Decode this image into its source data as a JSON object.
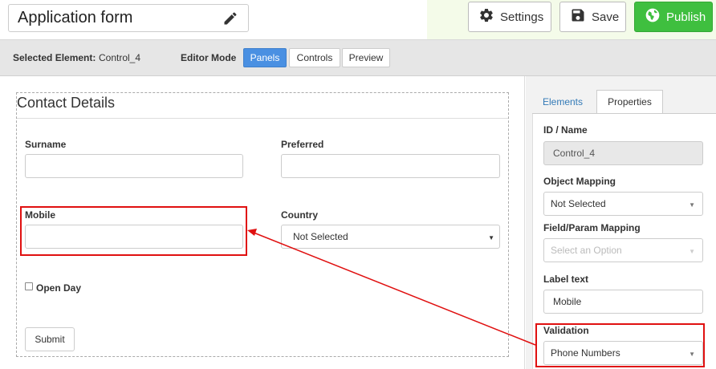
{
  "header": {
    "form_title": "Application form",
    "settings_label": "Settings",
    "save_label": "Save",
    "publish_label": "Publish"
  },
  "toolbar": {
    "selected_element_label": "Selected Element:",
    "selected_element_value": "Control_4",
    "editor_mode_label": "Editor Mode",
    "modes": [
      "Panels",
      "Controls",
      "Preview"
    ],
    "active_mode": "Panels"
  },
  "form": {
    "panel_title": "Contact Details",
    "fields": {
      "surname_label": "Surname",
      "preferred_label": "Preferred",
      "mobile_label": "Mobile",
      "country_label": "Country",
      "country_value": "Not Selected",
      "open_day_label": "Open Day"
    },
    "submit_label": "Submit"
  },
  "sidebar": {
    "tabs": [
      "Elements",
      "Properties"
    ],
    "active_tab": "Properties",
    "properties": {
      "id_label": "ID / Name",
      "id_value": "Control_4",
      "object_mapping_label": "Object Mapping",
      "object_mapping_value": "Not Selected",
      "field_mapping_label": "Field/Param Mapping",
      "field_mapping_placeholder": "Select an Option",
      "label_text_label": "Label text",
      "label_text_value": "Mobile",
      "validation_label": "Validation",
      "validation_value": "Phone Numbers"
    }
  },
  "colors": {
    "publish_green": "#3fbf3f",
    "active_mode_blue": "#4a90e2",
    "annotation_red": "#e01010",
    "link_blue": "#337ab7"
  },
  "icons": {
    "edit": "pencil-icon",
    "settings": "gear-icon",
    "save": "floppy-disk-icon",
    "publish": "globe-icon"
  }
}
